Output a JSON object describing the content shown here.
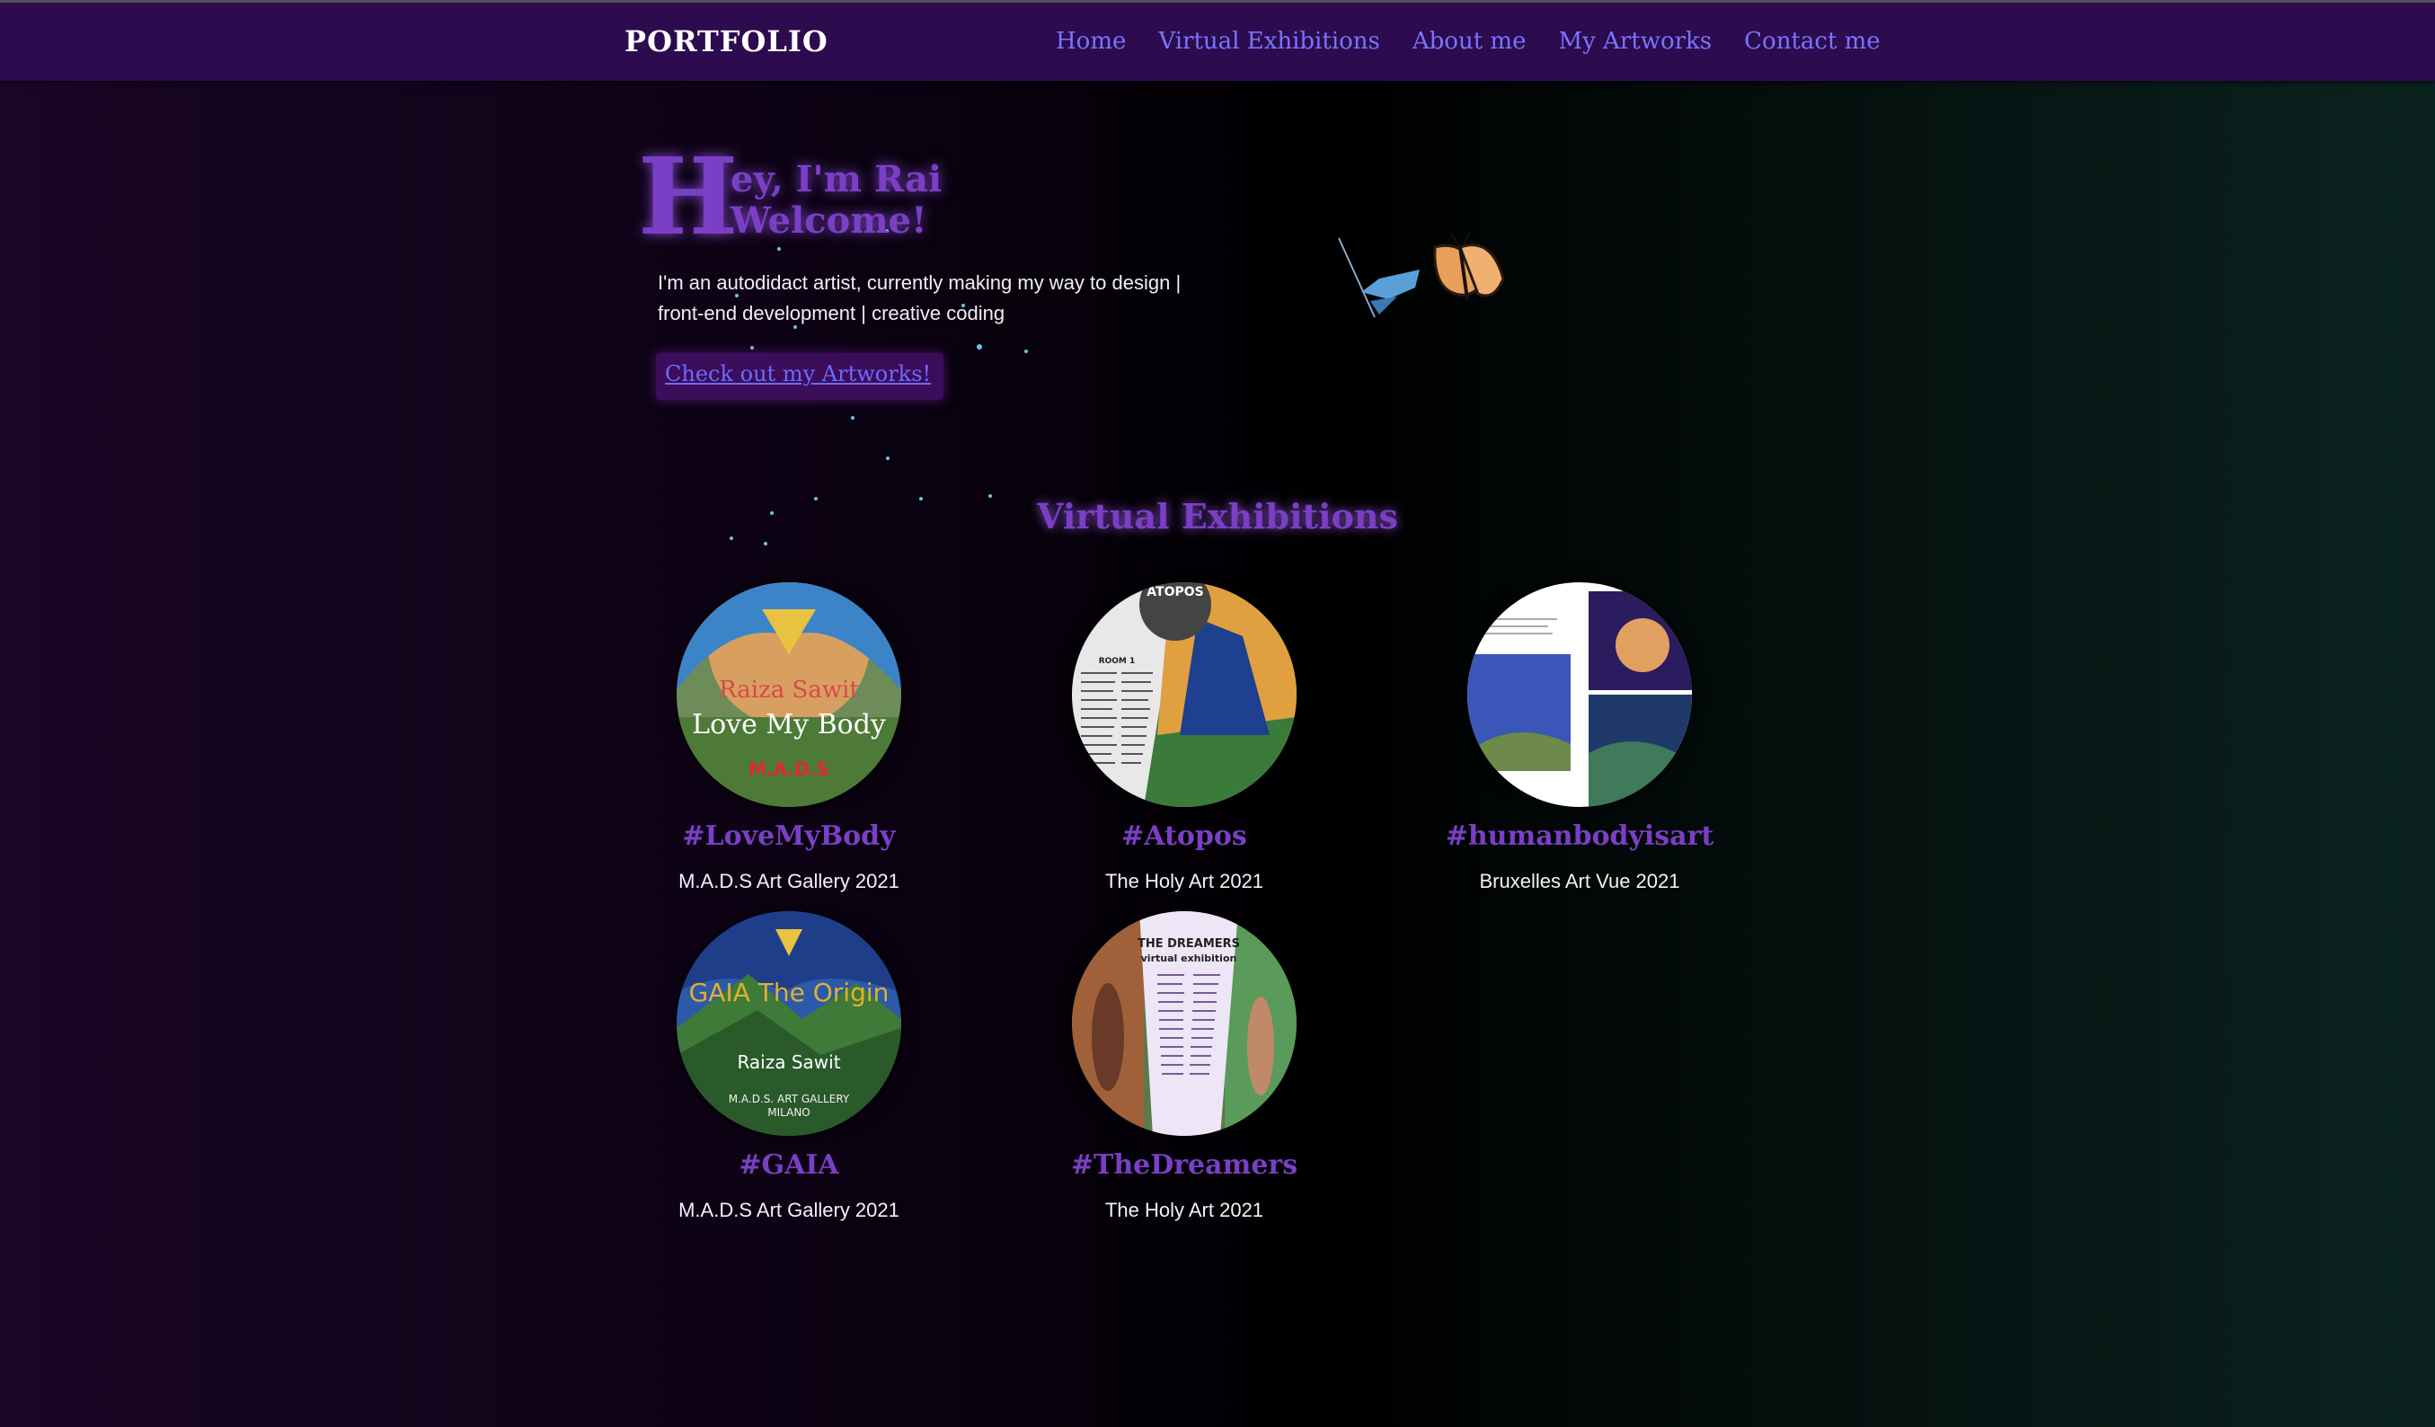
{
  "nav": {
    "brand": "PORTFOLIO",
    "links": [
      "Home",
      "Virtual Exhibitions",
      "About me",
      "My Artworks",
      "Contact me"
    ]
  },
  "hero": {
    "big_letter": "H",
    "line1": "ey, I'm Rai",
    "line2": "Welcome!",
    "description": "I'm an autodidact artist, currently making my way to design | front-end development | creative coding",
    "cta": "Check out my Artworks!"
  },
  "exhibitions": {
    "title": "Virtual Exhibitions",
    "items": [
      {
        "tag": "#LoveMyBody",
        "venue": "M.A.D.S Art Gallery 2021",
        "thumb_text": [
          "Raiza Sawit",
          "Love My Body",
          "M.A.D.S"
        ]
      },
      {
        "tag": "#Atopos",
        "venue": "The Holy Art 2021",
        "thumb_text": [
          "ATOPOS",
          "ROOM 1"
        ]
      },
      {
        "tag": "#humanbodyisart",
        "venue": "Bruxelles Art Vue 2021",
        "thumb_text": []
      },
      {
        "tag": "#GAIA",
        "venue": "M.A.D.S Art Gallery 2021",
        "thumb_text": [
          "GAIA The Origin",
          "Raiza Sawit",
          "M.A.D.S. ART GALLERY",
          "MILANO"
        ]
      },
      {
        "tag": "#TheDreamers",
        "venue": "The Holy Art 2021",
        "thumb_text": [
          "THE DREAMERS",
          "virtual exhibition"
        ]
      }
    ]
  },
  "colors": {
    "navbar": "#2c0b4e",
    "accent_purple": "#7a3fc4",
    "link_blue": "#7a74ff"
  }
}
